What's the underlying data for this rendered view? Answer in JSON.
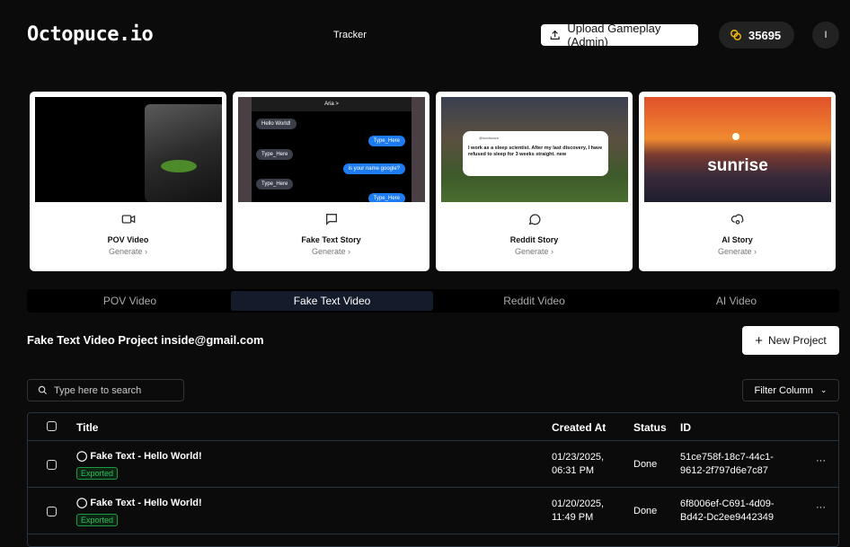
{
  "header": {
    "logo": "Octopuce.io",
    "nav_tracker": "Tracker",
    "upload_label": "Upload Gameplay (Admin)",
    "coins": "35695",
    "avatar_initial": "I"
  },
  "cards": [
    {
      "title": "POV Video",
      "action": "Generate ›",
      "icon": "video-icon"
    },
    {
      "title": "Fake Text Story",
      "action": "Generate ›",
      "icon": "message-square-icon",
      "preview": {
        "contact": "Aria >",
        "messages": [
          "Hello World!",
          "Type_Here",
          "Type_Here",
          "is your name google?",
          "Type_Here",
          "Type_Here"
        ]
      }
    },
    {
      "title": "Reddit Story",
      "action": "Generate ›",
      "icon": "message-circle-icon",
      "preview": {
        "handle": "@lucidscare",
        "text": "I work as a sleep scientist. After my last discovery, I have refused to sleep for 3 weeks straight. new"
      }
    },
    {
      "title": "AI Story",
      "action": "Generate ›",
      "icon": "cloud-cog-icon",
      "preview": {
        "caption": "sunrise"
      }
    }
  ],
  "tabs": [
    "POV Video",
    "Fake Text Video",
    "Reddit Video",
    "AI Video"
  ],
  "active_tab": 1,
  "section": {
    "heading": "Fake Text Video Project inside@gmail.com",
    "new_project": "New Project",
    "search_placeholder": "Type here to search",
    "filter": "Filter Column"
  },
  "table": {
    "columns": [
      "Title",
      "Created At",
      "Status",
      "ID"
    ],
    "rows": [
      {
        "title": "Fake Text - Hello World!",
        "badge": "Exported",
        "date": "01/23/2025,",
        "time": "06:31 PM",
        "status": "Done",
        "id1": "51ce758f-18c7-44c1-",
        "id2": "9612-2f797d6e7c87"
      },
      {
        "title": "Fake Text - Hello World!",
        "badge": "Exported",
        "date": "01/20/2025,",
        "time": "11:49 PM",
        "status": "Done",
        "id1": "6f8006ef-C691-4d09-",
        "id2": "Bd42-Dc2ee9442349"
      }
    ]
  }
}
